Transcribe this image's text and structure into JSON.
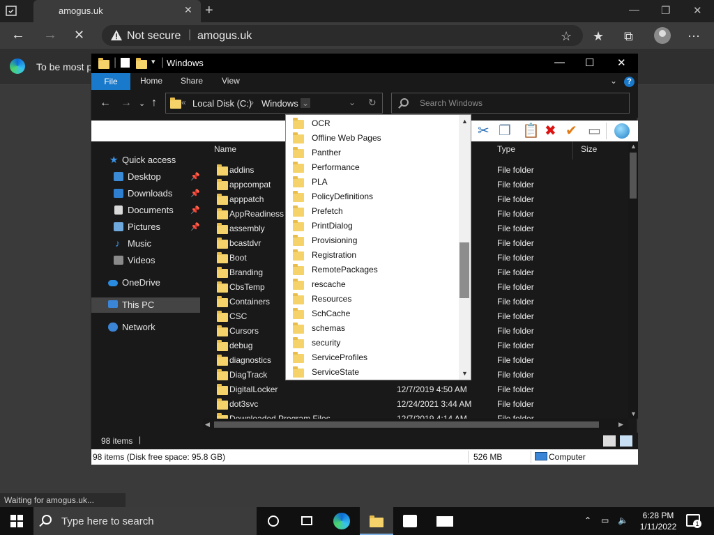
{
  "browser": {
    "tab_title": "amogus.uk",
    "tab_close": "✕",
    "new_tab": "+",
    "address_security": "Not secure",
    "address_url": "amogus.uk",
    "banner_text": "To be most pr",
    "status_loading": "Waiting for amogus.uk..."
  },
  "explorer": {
    "title": "Windows",
    "ribbon_tabs": [
      "File",
      "Home",
      "Share",
      "View"
    ],
    "breadcrumb": [
      "Local Disk (C:)",
      "Windows"
    ],
    "search_placeholder": "Search Windows",
    "nav": [
      {
        "label": "Quick access",
        "pinned": false
      },
      {
        "label": "Desktop",
        "pinned": true
      },
      {
        "label": "Downloads",
        "pinned": true
      },
      {
        "label": "Documents",
        "pinned": true
      },
      {
        "label": "Pictures",
        "pinned": true
      },
      {
        "label": "Music",
        "pinned": false
      },
      {
        "label": "Videos",
        "pinned": false
      },
      {
        "label": "OneDrive",
        "pinned": false
      },
      {
        "label": "This PC",
        "pinned": false
      },
      {
        "label": "Network",
        "pinned": false
      }
    ],
    "columns": {
      "name": "Name",
      "type": "Type",
      "size": "Size"
    },
    "files": [
      {
        "name": "addins",
        "date": "",
        "type": "File folder"
      },
      {
        "name": "appcompat",
        "date": "",
        "type": "File folder"
      },
      {
        "name": "apppatch",
        "date": "",
        "type": "File folder"
      },
      {
        "name": "AppReadiness",
        "date": "",
        "type": "File folder"
      },
      {
        "name": "assembly",
        "date": "",
        "type": "File folder"
      },
      {
        "name": "bcastdvr",
        "date": "",
        "type": "File folder"
      },
      {
        "name": "Boot",
        "date": "",
        "type": "File folder"
      },
      {
        "name": "Branding",
        "date": "",
        "type": "File folder"
      },
      {
        "name": "CbsTemp",
        "date": "",
        "type": "File folder"
      },
      {
        "name": "Containers",
        "date": "",
        "type": "File folder"
      },
      {
        "name": "CSC",
        "date": "",
        "type": "File folder"
      },
      {
        "name": "Cursors",
        "date": "",
        "type": "File folder"
      },
      {
        "name": "debug",
        "date": "",
        "type": "File folder"
      },
      {
        "name": "diagnostics",
        "date": "",
        "type": "File folder"
      },
      {
        "name": "DiagTrack",
        "date": "",
        "type": "File folder"
      },
      {
        "name": "DigitalLocker",
        "date": "12/7/2019 4:50 AM",
        "type": "File folder"
      },
      {
        "name": "dot3svc",
        "date": "12/24/2021 3:44 AM",
        "type": "File folder"
      },
      {
        "name": "Downloaded Program Files",
        "date": "12/7/2019 4:14 AM",
        "type": "File folder"
      }
    ],
    "items_count": "98 items",
    "status_free": "98 items (Disk free space: 95.8 GB)",
    "status_size": "526 MB",
    "status_location": "Computer"
  },
  "dropdown": [
    "OCR",
    "Offline Web Pages",
    "Panther",
    "Performance",
    "PLA",
    "PolicyDefinitions",
    "Prefetch",
    "PrintDialog",
    "Provisioning",
    "Registration",
    "RemotePackages",
    "rescache",
    "Resources",
    "SchCache",
    "schemas",
    "security",
    "ServiceProfiles",
    "ServiceState"
  ],
  "taskbar": {
    "search_text": "Type here to search",
    "time": "6:28 PM",
    "date": "1/11/2022",
    "notification_count": "1"
  },
  "colors": {
    "accent": "#1979ca",
    "folder": "#f5d36a"
  }
}
